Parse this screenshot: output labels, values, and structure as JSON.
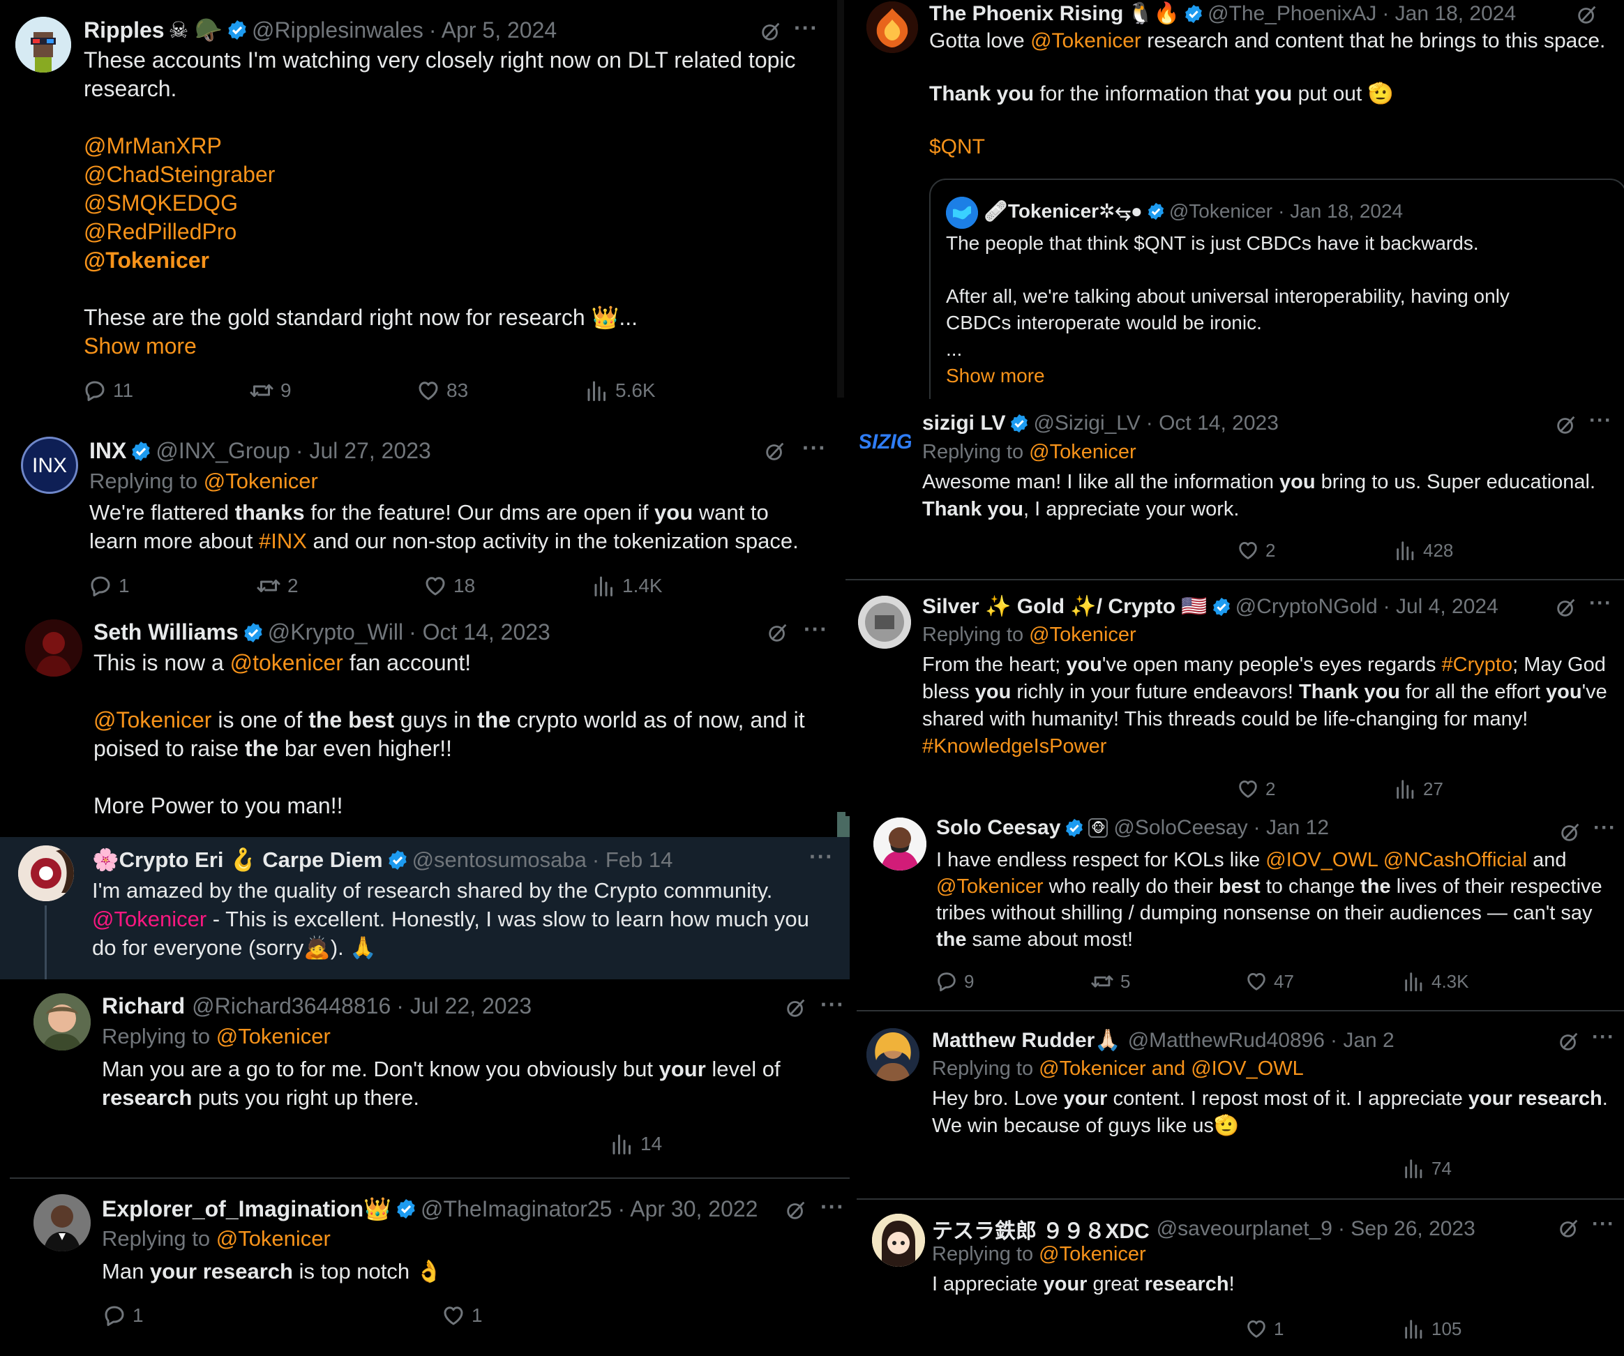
{
  "colors": {
    "mention": "#f7931a",
    "mention_pink": "#f91880",
    "verified": "#1d9bf0",
    "muted": "#71767b",
    "text": "#e7e9ea"
  },
  "tweets": {
    "ripples": {
      "name": "Ripples",
      "emoji": "☠ 🪖",
      "handle": "@Ripplesinwales",
      "date": "· Apr 5, 2024",
      "l1": "These accounts I'm watching very closely right now on DLT related topic",
      "l2": "research.",
      "m1": "@MrManXRP",
      "m2": "@ChadSteingraber",
      "m3": "@SMQKEDQG",
      "m4": "@RedPilledPro",
      "m5": "@Tokenicer",
      "l3": "These are the gold standard right now for research 👑...",
      "more": "Show more",
      "replies": "11",
      "reposts": "9",
      "likes": "83",
      "views": "5.6K"
    },
    "phoenix": {
      "name": "The Phoenix Rising",
      "emoji": "🐧🔥",
      "handle": "@The_PhoenixAJ",
      "date": "· Jan 18, 2024",
      "a1": "Gotta love ",
      "a2": "@Tokenicer",
      "a3": " research and content that he brings to this space.",
      "b1": "Thank you",
      "b2": " for the information that ",
      "b3": "you",
      "b4": " put out 🫡",
      "tag": "$QNT",
      "quote": {
        "name": "🩹Tokenicer✲⥃●",
        "handle": "@Tokenicer",
        "date": "· Jan 18, 2024",
        "l1": "The people that think $QNT is just CBDCs have it backwards.",
        "l2": "After all, we're talking about universal interoperability, having only",
        "l3": "CBDCs interoperate would be ironic.",
        "l4": "...",
        "more": "Show more"
      }
    },
    "inx": {
      "name": "INX",
      "handle": "@INX_Group",
      "date": "· Jul 27, 2023",
      "replying": "Replying to ",
      "to": "@Tokenicer",
      "a1": "We're flattered ",
      "a2": "thanks",
      "a3": " for the feature! Our dms are open if ",
      "a4": "you",
      "a5": " want to",
      "b1": "learn more about ",
      "b2": "#INX",
      "b3": " and our non-stop activity in the tokenization space.",
      "replies": "1",
      "reposts": "2",
      "likes": "18",
      "views": "1.4K"
    },
    "sizigi": {
      "name": "sizigi LV",
      "handle": "@Sizigi_LV",
      "date": "· Oct 14, 2023",
      "replying": "Replying to ",
      "to": "@Tokenicer",
      "a1": "Awesome man! I like all the information ",
      "a2": "you",
      "a3": " bring  to us. Super educational.",
      "b1": "Thank you",
      "b2": ", I appreciate your work.",
      "likes": "2",
      "views": "428"
    },
    "seth": {
      "name": "Seth Williams",
      "handle": "@Krypto_Will",
      "date": "· Oct 14, 2023",
      "a1": "This is now a ",
      "a2": "@tokenicer",
      "a3": " fan account!",
      "b1": "@Tokenicer",
      "b2": " is one of ",
      "b3": "the best",
      "b4": " guys in ",
      "b5": "the",
      "b6": " crypto world as of now, and it",
      "c1": "poised to raise ",
      "c2": "the",
      "c3": " bar even higher!!",
      "d1": "More Power to you man!!"
    },
    "silver": {
      "name": "Silver ✨ Gold ✨/ Crypto 🇺🇸",
      "handle": "@CryptoNGold",
      "date": "· Jul 4, 2024",
      "replying": "Replying to ",
      "to": "@Tokenicer",
      "a1": "From the heart; ",
      "a2": "you",
      "a3": "'ve open many people's eyes regards ",
      "a4": "#Crypto",
      "a5": "; May God",
      "b1": "bless ",
      "b2": "you",
      "b3": " richly in your future endeavors! ",
      "b4": "Thank you",
      "b5": " for all the effort ",
      "b6": "you",
      "b7": "'ve",
      "c1": "shared with humanity! This threads could be life-changing for many!",
      "d1": "#KnowledgeIsPower",
      "likes": "2",
      "views": "27"
    },
    "eri": {
      "name": "🌸Crypto Eri 🪝 Carpe Diem",
      "handle": "@sentosumosaba",
      "date": "· Feb 14",
      "a1": "I'm amazed by the quality of research shared by the Crypto community.",
      "b1": "@Tokenicer",
      "b2": " - This is excellent. Honestly, I was slow to learn how much you",
      "c1": "do for everyone (sorry🙇). 🙏"
    },
    "solo": {
      "name": "Solo Ceesay",
      "emoji": "🐵",
      "handle": "@SoloCeesay",
      "date": "· Jan 12",
      "a1": "I have endless respect for KOLs like ",
      "a2": "@IOV_OWL",
      "a3": " ",
      "a4": "@NCashOfficial",
      "a5": " and",
      "b1": "@Tokenicer",
      "b2": " who really do their ",
      "b3": "best",
      "b4": " to change ",
      "b5": "the",
      "b6": " lives of their respective",
      "c1": "tribes without shilling / dumping nonsense on their audiences — can't say",
      "d1": "the",
      "d2": " same about most!",
      "replies": "9",
      "reposts": "5",
      "likes": "47",
      "views": "4.3K"
    },
    "richard": {
      "name": "Richard",
      "handle": "@Richard36448816",
      "date": "· Jul 22, 2023",
      "replying": "Replying to ",
      "to": "@Tokenicer",
      "a1": "Man you are a go to for me. Don't know you obviously but ",
      "a2": "your",
      "a3": " level of",
      "b1": "research",
      "b2": " puts you right up there.",
      "views": "14"
    },
    "matthew": {
      "name": "Matthew Rudder🙏🏻",
      "handle": "@MatthewRud40896",
      "date": "· Jan 2",
      "replying": "Replying to ",
      "to": "@Tokenicer and @IOV_OWL",
      "a1": "Hey bro. Love ",
      "a2": "your",
      "a3": " content. I repost most of it. I appreciate ",
      "a4": "your research",
      ".": ".",
      "a5": ".",
      "b1": "We win because of guys like us🫡",
      "views": "74"
    },
    "explorer": {
      "name": "Explorer_of_Imagination👑",
      "handle": "@TheImaginator25",
      "date": "· Apr 30, 2022",
      "replying": "Replying to ",
      "to": "@Tokenicer",
      "a1": "Man ",
      "a2": "your research",
      "a3": " is top notch 👌",
      "replies": "1",
      "likes": "1"
    },
    "tesla": {
      "name": "テスラ鉄郎 ９９８XDC",
      "handle": "@saveourplanet_9",
      "date": "· Sep 26, 2023",
      "replying": "Replying to ",
      "to": "@Tokenicer",
      "a1": "I appreciate ",
      "a2": "your",
      "a3": " great ",
      "a4": "research",
      "a5": "!",
      "likes": "1",
      "views": "105"
    }
  }
}
